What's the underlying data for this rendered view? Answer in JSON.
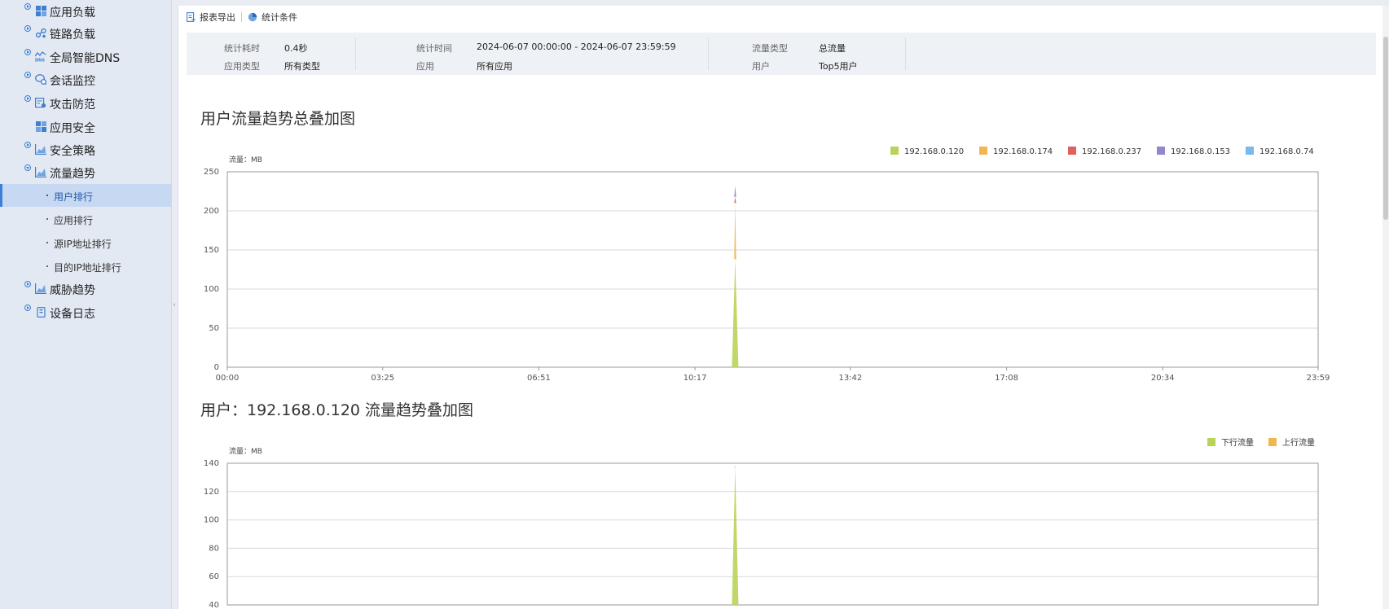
{
  "sidebar": {
    "items": [
      {
        "label": "应用负载",
        "icon": "app-load-icon"
      },
      {
        "label": "链路负载",
        "icon": "link-load-icon"
      },
      {
        "label": "全局智能DNS",
        "icon": "dns-icon"
      },
      {
        "label": "会话监控",
        "icon": "session-monitor-icon"
      },
      {
        "label": "攻击防范",
        "icon": "attack-defense-icon"
      },
      {
        "label": "应用安全",
        "icon": "app-security-icon"
      },
      {
        "label": "安全策略",
        "icon": "security-policy-icon"
      },
      {
        "label": "流量趋势",
        "icon": "traffic-trend-icon"
      },
      {
        "label": "威胁趋势",
        "icon": "threat-trend-icon"
      },
      {
        "label": "设备日志",
        "icon": "device-log-icon"
      }
    ],
    "subitems": [
      "用户排行",
      "应用排行",
      "源IP地址排行",
      "目的IP地址排行"
    ]
  },
  "toolbar": {
    "export_label": "报表导出",
    "conditions_label": "统计条件"
  },
  "summary": {
    "elapsed_key": "统计耗时",
    "elapsed_value": "0.4秒",
    "apptype_key": "应用类型",
    "apptype_value": "所有类型",
    "time_key": "统计时间",
    "time_value": "2024-06-07 00:00:00 - 2024-06-07 23:59:59",
    "app_key": "应用",
    "app_value": "所有应用",
    "traffic_type_key": "流量类型",
    "traffic_type_value": "总流量",
    "user_key": "用户",
    "user_value": "Top5用户"
  },
  "colors": {
    "green": "#b9d35a",
    "orange": "#f3b550",
    "red": "#e06060",
    "purple": "#9187cc",
    "blue": "#7db8ea"
  },
  "chart_data": [
    {
      "type": "area",
      "title": "用户流量趋势总叠加图",
      "unit_label": "流量：MB",
      "x_ticks": [
        "00:00",
        "03:25",
        "06:51",
        "10:17",
        "13:42",
        "17:08",
        "20:34",
        "23:59"
      ],
      "ylim": [
        0,
        250
      ],
      "y_ticks": [
        0,
        50,
        100,
        150,
        200,
        250
      ],
      "stacked": true,
      "grid": true,
      "legend_position": "top-right",
      "spike_time": "11:10",
      "series": [
        {
          "name": "192.168.0.120",
          "color": "#b9d35a",
          "peak": 138
        },
        {
          "name": "192.168.0.174",
          "color": "#f3b550",
          "peak": 72
        },
        {
          "name": "192.168.0.237",
          "color": "#e06060",
          "peak": 8
        },
        {
          "name": "192.168.0.153",
          "color": "#9187cc",
          "peak": 14
        },
        {
          "name": "192.168.0.74",
          "color": "#7db8ea",
          "peak": 0
        }
      ]
    },
    {
      "type": "area",
      "title": "用户：192.168.0.120 流量趋势叠加图",
      "unit_label": "流量：MB",
      "ylim": [
        40,
        140
      ],
      "y_ticks": [
        40,
        60,
        80,
        100,
        120,
        140
      ],
      "stacked": true,
      "grid": true,
      "legend_position": "top-right",
      "spike_time": "11:10",
      "series": [
        {
          "name": "下行流量",
          "color": "#b9d35a",
          "peak": 137
        },
        {
          "name": "上行流量",
          "color": "#f3b550",
          "peak": 1
        }
      ]
    }
  ]
}
